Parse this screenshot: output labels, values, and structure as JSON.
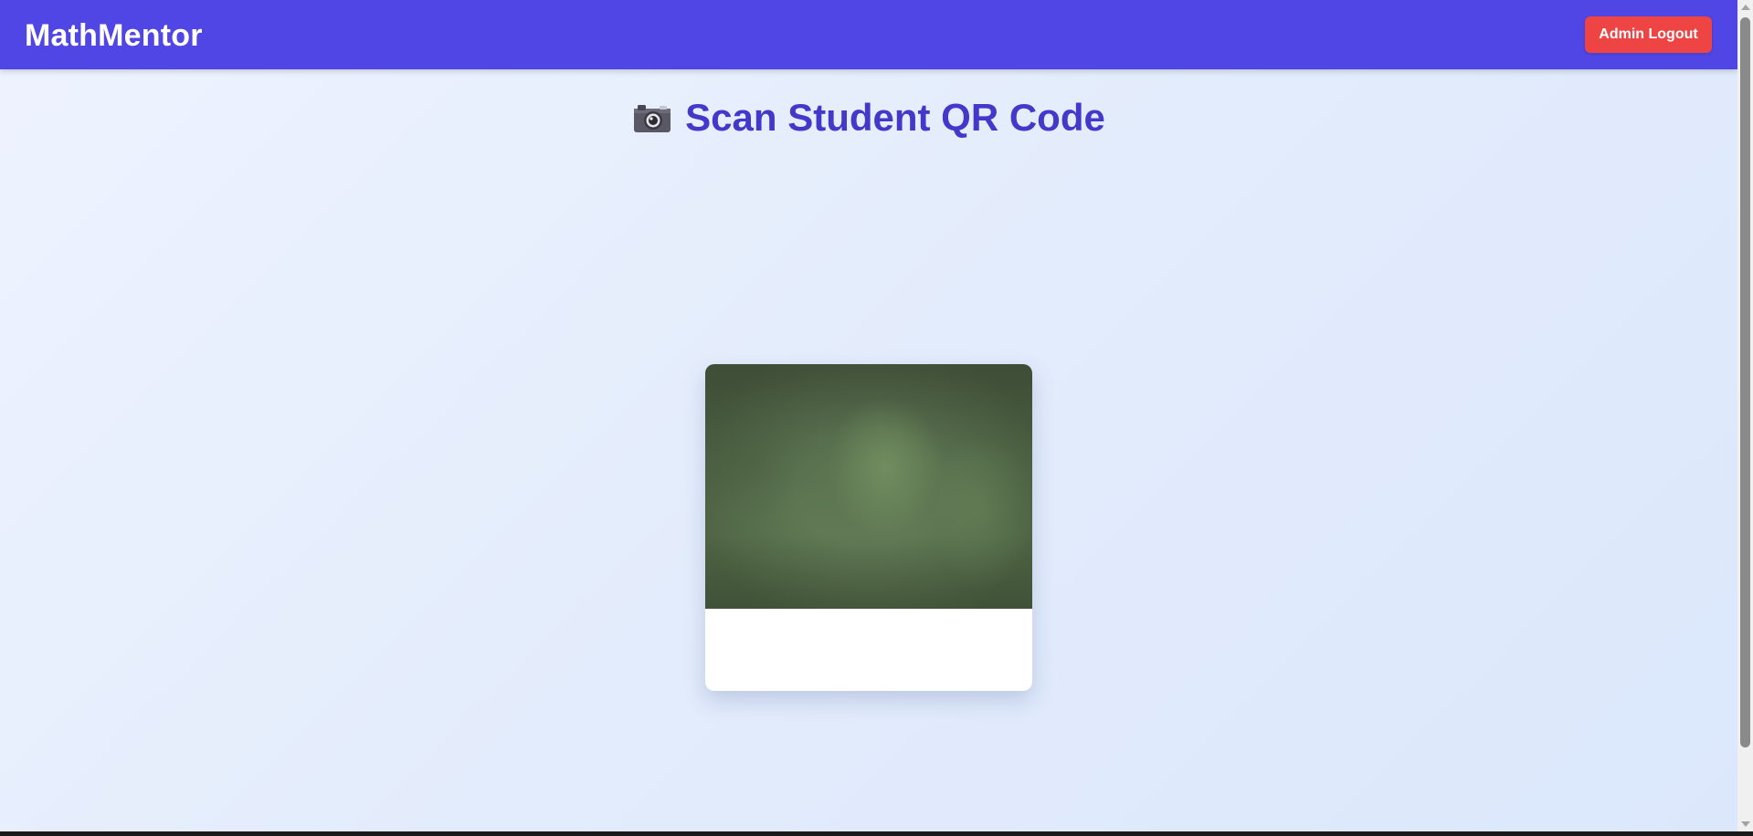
{
  "app": {
    "brand": "MathMentor"
  },
  "navbar": {
    "logout_label": "Admin Logout",
    "accent_color": "#4f46e5",
    "logout_color": "#ef4444"
  },
  "main": {
    "title": "Scan Student QR Code",
    "title_icon": "camera-icon",
    "title_color": "#4338ca"
  },
  "scanner": {
    "feed_state": "camera-preview"
  }
}
